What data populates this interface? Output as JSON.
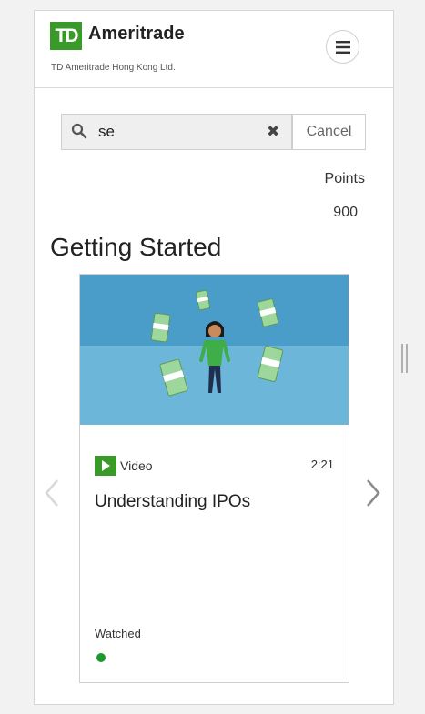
{
  "header": {
    "logo_mark": "TD",
    "logo_word": "Ameritrade",
    "subtitle": "TD Ameritrade Hong Kong Ltd.",
    "menu_icon": "hamburger-icon"
  },
  "search": {
    "value": "se",
    "placeholder": "",
    "cancel_label": "Cancel"
  },
  "points": {
    "label": "Points",
    "value": "900"
  },
  "section": {
    "title": "Getting Started"
  },
  "card": {
    "type_label": "Video",
    "duration": "2:21",
    "title": "Understanding IPOs",
    "status": "Watched",
    "status_color": "#1a9a2a"
  },
  "colors": {
    "brand_green": "#3a9a29",
    "image_sky": "#4a9cc9",
    "image_floor": "#6cb6d9"
  }
}
